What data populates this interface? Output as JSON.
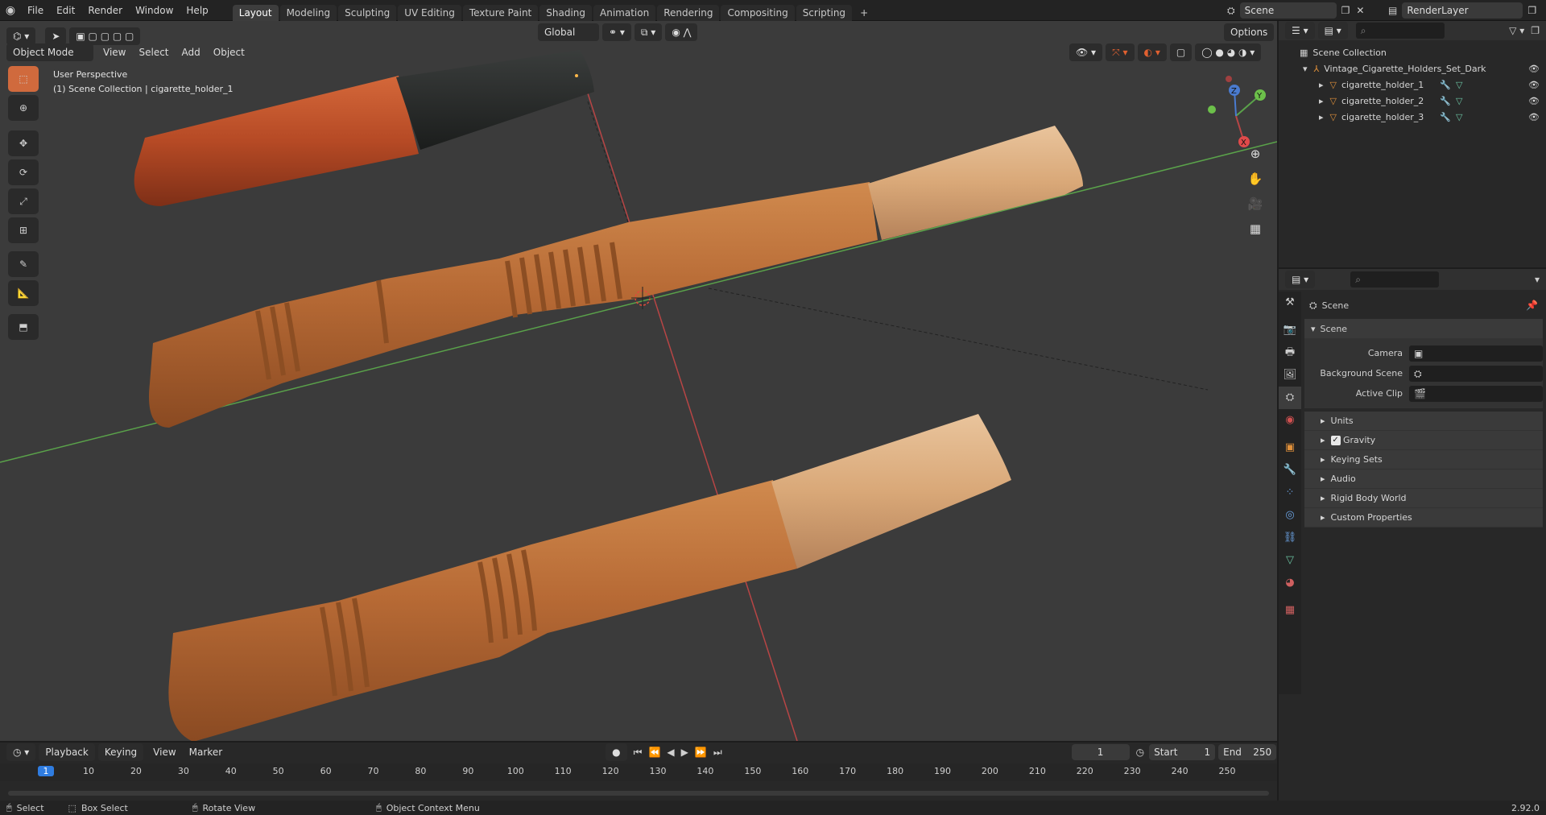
{
  "menu": {
    "file": "File",
    "edit": "Edit",
    "render": "Render",
    "window": "Window",
    "help": "Help"
  },
  "workspaces": [
    "Layout",
    "Modeling",
    "Sculpting",
    "UV Editing",
    "Texture Paint",
    "Shading",
    "Animation",
    "Rendering",
    "Compositing",
    "Scripting"
  ],
  "active_workspace": "Layout",
  "scene_field": "Scene",
  "renderlayer_field": "RenderLayer",
  "viewport": {
    "mode": "Object Mode",
    "menu": {
      "view": "View",
      "select": "Select",
      "add": "Add",
      "object": "Object"
    },
    "orientation": "Global",
    "options": "Options",
    "overlay_title": "User Perspective",
    "overlay_sub": "(1) Scene Collection | cigarette_holder_1",
    "axis": {
      "x": "X",
      "y": "Y",
      "z": "Z"
    }
  },
  "outliner": {
    "root": "Scene Collection",
    "collection": "Vintage_Cigarette_Holders_Set_Dark",
    "items": [
      "cigarette_holder_1",
      "cigarette_holder_2",
      "cigarette_holder_3"
    ]
  },
  "properties": {
    "breadcrumb": "Scene",
    "section": "Scene",
    "camera_label": "Camera",
    "bgscene_label": "Background Scene",
    "clip_label": "Active Clip",
    "panels": [
      "Units",
      "Gravity",
      "Keying Sets",
      "Audio",
      "Rigid Body World",
      "Custom Properties"
    ]
  },
  "timeline": {
    "playback": "Playback",
    "keying": "Keying",
    "view": "View",
    "marker": "Marker",
    "current_frame": "1",
    "start_label": "Start",
    "start": "1",
    "end_label": "End",
    "end": "250",
    "ticks": [
      "1",
      "10",
      "20",
      "30",
      "40",
      "50",
      "60",
      "70",
      "80",
      "90",
      "100",
      "110",
      "120",
      "130",
      "140",
      "150",
      "160",
      "170",
      "180",
      "190",
      "200",
      "210",
      "220",
      "230",
      "240",
      "250"
    ]
  },
  "status": {
    "select": "Select",
    "box_select": "Box Select",
    "rotate": "Rotate View",
    "context": "Object Context Menu",
    "version": "2.92.0"
  },
  "colors": {
    "accent": "#d06a3d",
    "wood": "#b76a35",
    "wood_light": "#d9a878",
    "burl": "#c1502a",
    "mouthpiece": "#2a2d2c"
  }
}
